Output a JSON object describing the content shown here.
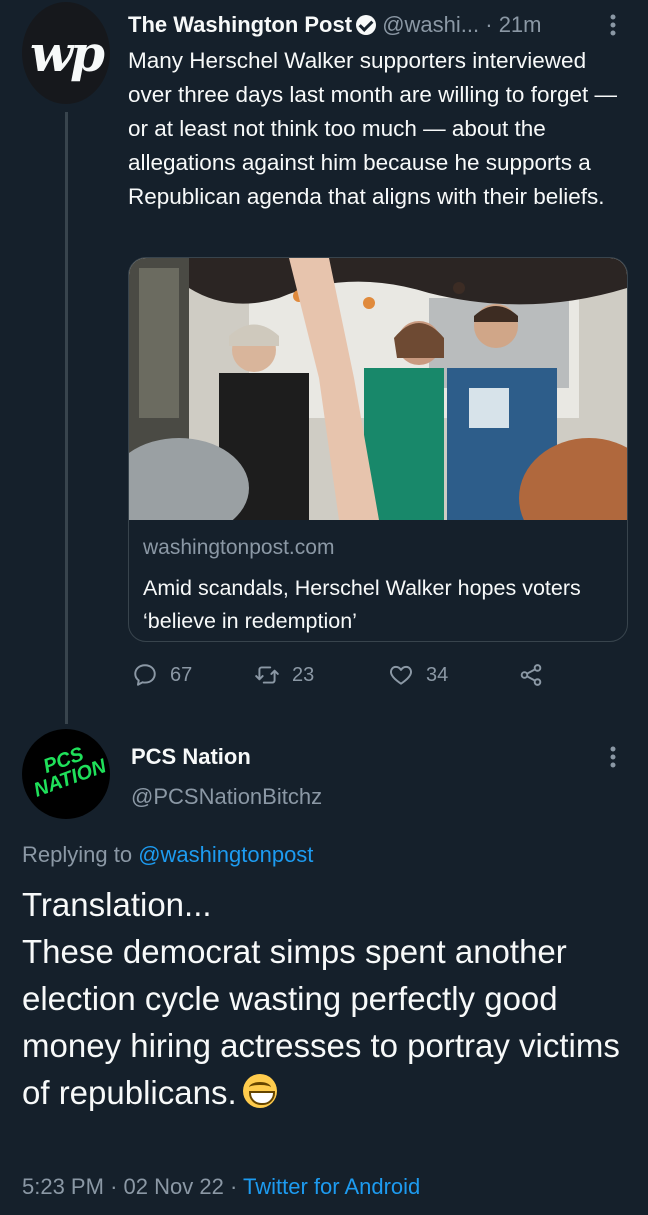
{
  "tweet1": {
    "author_name": "The Washington Post",
    "handle": "@washi...",
    "separator": "·",
    "time": "21m",
    "avatar_text": "wp",
    "text": "Many Herschel Walker supporters interviewed over three days last month are willing to forget — or at least not think too much — about the allegations against him because he supports a Republican agenda that aligns with their beliefs.",
    "card": {
      "domain": "washingtonpost.com",
      "title": "Amid scandals, Herschel Walker hopes voters ‘believe in redemption’"
    },
    "actions": {
      "replies": "67",
      "retweets": "23",
      "likes": "34"
    }
  },
  "tweet2": {
    "author_name": "PCS Nation",
    "handle": "@PCSNationBitchz",
    "avatar_text": "PCS NATION",
    "replying_prefix": "Replying to",
    "replying_handle": "@washingtonpost",
    "text_line1": "Translation...",
    "text_body": "These democrat simps spent another election cycle wasting perfectly good money hiring actresses to portray victims of republicans.",
    "meta_time": "5:23 PM",
    "meta_sep1": "·",
    "meta_date": "02 Nov 22",
    "meta_sep2": "·",
    "meta_source": "Twitter for Android"
  },
  "icons": {
    "verified": "verified-badge-icon",
    "more": "more-options-icon",
    "reply": "reply-icon",
    "retweet": "retweet-icon",
    "like": "heart-icon",
    "share": "share-icon",
    "emoji": "grinning-face-emoji"
  },
  "colors": {
    "background": "#15202b",
    "text": "#f7f9f9",
    "muted": "#8b98a5",
    "link": "#1d9bf0",
    "border": "#38444d",
    "pcs_green": "#1fe05a"
  }
}
